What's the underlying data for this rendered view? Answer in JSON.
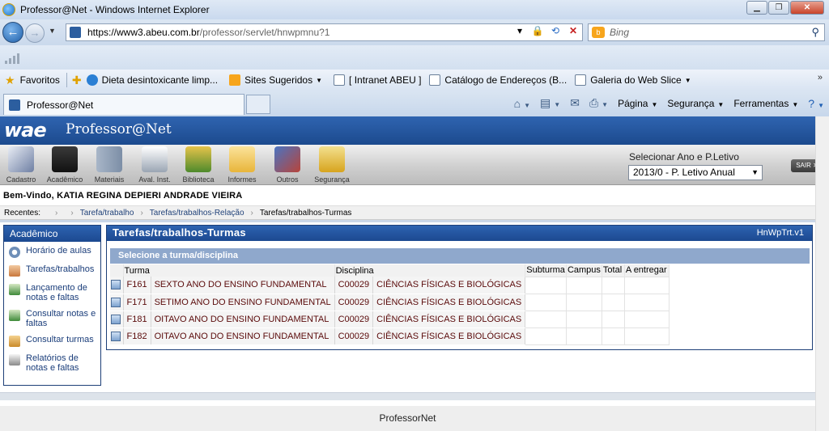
{
  "browser": {
    "window_title": "Professor@Net - Windows Internet Explorer",
    "url_domain": "https://www3.abeu.com.br",
    "url_path": "/professor/servlet/hnwpmnu?1",
    "search_placeholder": "Bing",
    "favorites": {
      "label": "Favoritos",
      "items": [
        {
          "label": "Dieta desintoxicante limp...",
          "icon": "globe-icon"
        },
        {
          "label": "Sites Sugeridos",
          "icon": "bing-icon",
          "dropdown": true
        },
        {
          "label": "[ Intranet ABEU ]",
          "icon": "page-icon"
        },
        {
          "label": "Catálogo de Endereços (B...",
          "icon": "page-icon"
        },
        {
          "label": "Galeria do Web Slice",
          "icon": "page-icon",
          "dropdown": true
        }
      ]
    },
    "tab_label": "Professor@Net",
    "commands": [
      "Página",
      "Segurança",
      "Ferramentas"
    ]
  },
  "app": {
    "logo": "wae",
    "title": "Professor@Net",
    "toolbar": [
      {
        "label": "Cadastro",
        "icon": "pencil-icon",
        "color": "#6e7fa3"
      },
      {
        "label": "Acadêmico",
        "icon": "graduation-cap-icon",
        "color": "#1e1e1e"
      },
      {
        "label": "Materiais",
        "icon": "books-icon",
        "color": "#7c8ea6"
      },
      {
        "label": "Aval. Inst.",
        "icon": "checklist-icon",
        "color": "#9aa5b3"
      },
      {
        "label": "Biblioteca",
        "icon": "library-icon",
        "color": "#4e8a2c"
      },
      {
        "label": "Informes",
        "icon": "envelope-icon",
        "color": "#e8b53a"
      },
      {
        "label": "Outros",
        "icon": "tools-icon",
        "color": "#b8443a"
      },
      {
        "label": "Segurança",
        "icon": "padlock-icon",
        "color": "#d7a41e"
      }
    ],
    "period_label": "Selecionar Ano e P.Letivo",
    "period_value": "2013/0 - P. Letivo Anual",
    "logout_label": "SAIR ✕",
    "welcome": "Bem-Vindo, KATIA REGINA DEPIERI ANDRADE VIEIRA",
    "breadcrumb": {
      "label": "Recentes:",
      "items": [
        "Tarefa/trabalho",
        "Tarefas/trabalhos-Relação",
        "Tarefas/trabalhos-Turmas"
      ]
    }
  },
  "sidebar": {
    "title": "Acadêmico",
    "items": [
      {
        "label": "Horário de aulas",
        "icon": "clock-icon",
        "color": "#6f8fb8"
      },
      {
        "label": "Tarefas/trabalhos",
        "icon": "notebook-icon",
        "color": "#c9783c"
      },
      {
        "label": "Lançamento de notas e faltas",
        "icon": "people-icon",
        "color": "#3f8a3a"
      },
      {
        "label": "Consultar notas e faltas",
        "icon": "people-search-icon",
        "color": "#3f8a3a"
      },
      {
        "label": "Consultar turmas",
        "icon": "group-icon",
        "color": "#c98a2a"
      },
      {
        "label": "Relatórios de notas e faltas",
        "icon": "report-icon",
        "color": "#8a8a8a"
      }
    ]
  },
  "main": {
    "title": "Tarefas/trabalhos-Turmas",
    "code": "HnWpTrt.v1",
    "subtitle": "Selecione a turma/disciplina",
    "columns": [
      "Turma",
      "Disciplina",
      "Subturma",
      "Campus",
      "Total",
      "A entregar"
    ],
    "rows": [
      {
        "turma": "F161",
        "nome": "SEXTO ANO DO ENSINO FUNDAMENTAL",
        "disc_code": "C00029",
        "disc_name": "CIÊNCIAS FÍSICAS E BIOLÓGICAS",
        "subturma": "",
        "campus": "",
        "total": "",
        "a_entregar": ""
      },
      {
        "turma": "F171",
        "nome": "SETIMO ANO DO ENSINO FUNDAMENTAL",
        "disc_code": "C00029",
        "disc_name": "CIÊNCIAS FÍSICAS E BIOLÓGICAS",
        "subturma": "",
        "campus": "",
        "total": "",
        "a_entregar": ""
      },
      {
        "turma": "F181",
        "nome": "OITAVO ANO DO ENSINO FUNDAMENTAL",
        "disc_code": "C00029",
        "disc_name": "CIÊNCIAS FÍSICAS E BIOLÓGICAS",
        "subturma": "",
        "campus": "",
        "total": "",
        "a_entregar": ""
      },
      {
        "turma": "F182",
        "nome": "OITAVO ANO DO ENSINO FUNDAMENTAL",
        "disc_code": "C00029",
        "disc_name": "CIÊNCIAS FÍSICAS E BIOLÓGICAS",
        "subturma": "",
        "campus": "",
        "total": "",
        "a_entregar": ""
      }
    ]
  },
  "footer": "ProfessorNet"
}
